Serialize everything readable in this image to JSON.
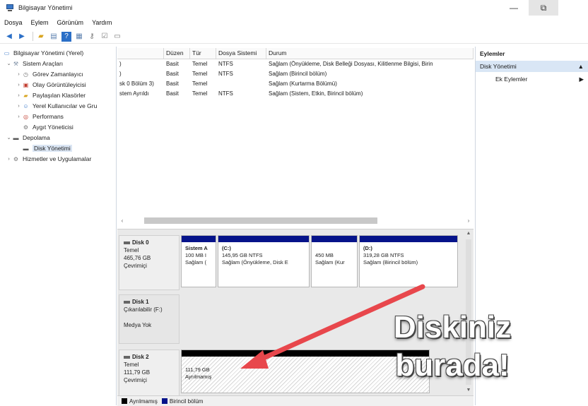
{
  "window": {
    "title": "Bilgisayar Yönetimi",
    "minimize": "—",
    "restore": "⧉",
    "close": ""
  },
  "menu": [
    "Dosya",
    "Eylem",
    "Görünüm",
    "Yardım"
  ],
  "tree": {
    "root": "Bilgisayar Yönetimi (Yerel)",
    "system_tools": "Sistem Araçları",
    "items": [
      "Görev Zamanlayıcı",
      "Olay Görüntüleyicisi",
      "Paylaşılan Klasörler",
      "Yerel Kullanıcılar ve Gru",
      "Performans",
      "Aygıt Yöneticisi"
    ],
    "storage": "Depolama",
    "disk_mgmt": "Disk Yönetimi",
    "services": "Hizmetler ve Uygulamalar"
  },
  "volume_list": {
    "headers": [
      "",
      "Düzen",
      "Tür",
      "Dosya Sistemi",
      "Durum"
    ],
    "rows": [
      [
        ")",
        "Basit",
        "Temel",
        "NTFS",
        "Sağlam (Önyükleme, Disk Belleği Dosyası, Kilitlenme Bilgisi, Birin"
      ],
      [
        ")",
        "Basit",
        "Temel",
        "NTFS",
        "Sağlam (Birincil bölüm)"
      ],
      [
        "sk 0 Bölüm 3)",
        "Basit",
        "Temel",
        "",
        "Sağlam (Kurtarma Bölümü)"
      ],
      [
        "stem Ayrıldı",
        "Basit",
        "Temel",
        "NTFS",
        "Sağlam (Sistem, Etkin, Birincil bölüm)"
      ]
    ]
  },
  "disks": [
    {
      "name": "Disk 0",
      "lines": [
        "Temel",
        "465,76 GB",
        "Çevrimiçi"
      ],
      "partitions": [
        {
          "name": "Sistem A",
          "size": "100 MB I",
          "status": "Sağlam ("
        },
        {
          "name": "(C:)",
          "size": "145,95 GB NTFS",
          "status": "Sağlam (Önyükleme, Disk E"
        },
        {
          "name": "",
          "size": "450 MB",
          "status": "Sağlam (Kur"
        },
        {
          "name": "(D:)",
          "size": "319,28 GB NTFS",
          "status": "Sağlam (Birincil bölüm)"
        }
      ]
    },
    {
      "name": "Disk 1",
      "lines": [
        "Çıkarılabilir (F:)",
        "",
        "Medya Yok"
      ]
    },
    {
      "name": "Disk 2",
      "lines": [
        "Temel",
        "111,79 GB",
        "Çevrimiçi"
      ],
      "unallocated": {
        "size": "111,79 GB",
        "label": "Ayrılmamış"
      }
    }
  ],
  "legend": [
    {
      "label": "Ayrılmamış",
      "color": "#000000"
    },
    {
      "label": "Birincil bölüm",
      "color": "#05138a"
    }
  ],
  "actions": {
    "header": "Eylemler",
    "section": "Disk Yönetimi",
    "more": "Ek Eylemler"
  },
  "overlay": {
    "line1": "Diskiniz",
    "line2": "burada!",
    "arrow_color": "#e8474c"
  }
}
